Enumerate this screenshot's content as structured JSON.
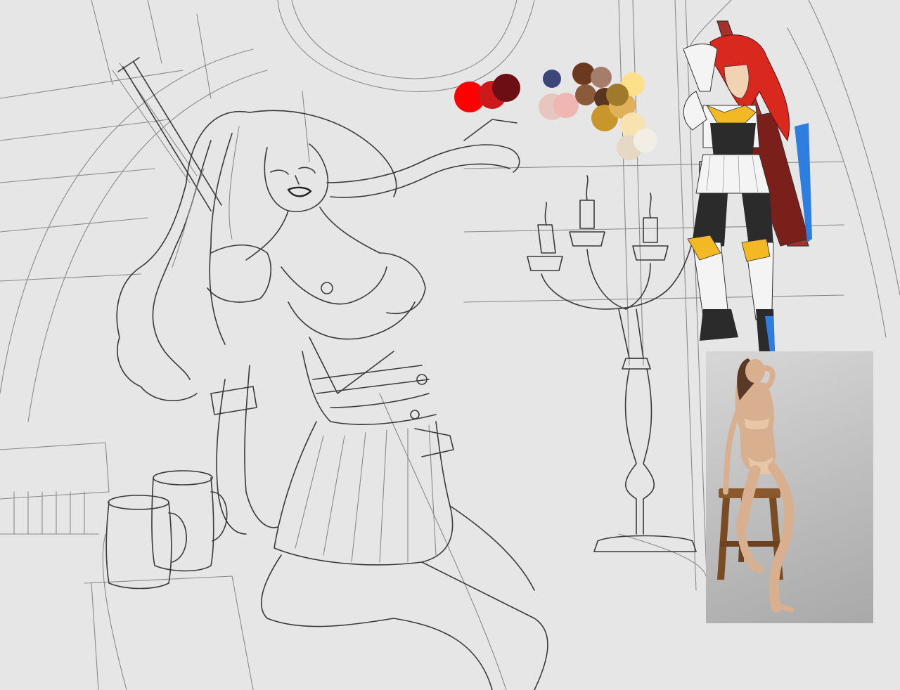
{
  "artwork": {
    "palette_colors": [
      "#ff0000",
      "#cc1a1a",
      "#6b0f14",
      "#3d4678",
      "#e8c6c0",
      "#f0b7b2",
      "#6b3a1e",
      "#8b5a3a",
      "#a67c6b",
      "#5a3520",
      "#c9962e",
      "#e0b15a",
      "#ffe08a",
      "#f7e2b0",
      "#e5d9c6",
      "#f2eee6",
      "#a07a2a"
    ],
    "reference_character": {
      "hair_color": "#d9281e",
      "armor_gold": "#f2b925",
      "armor_white": "#f4f4f4",
      "legwear_black": "#2b2b2b",
      "sword_red": "#a8302a"
    },
    "reference_photo": {
      "backdrop": "#c4c4c4",
      "stool": "#8a5a2e",
      "skin": "#d9b08f"
    },
    "sketch_line_color": "#3a3a3a",
    "background_color": "#e6e6e6"
  }
}
